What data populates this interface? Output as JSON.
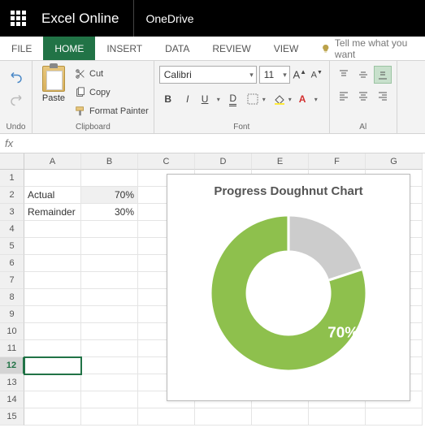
{
  "titlebar": {
    "app": "Excel Online",
    "location": "OneDrive"
  },
  "tabs": {
    "file": "FILE",
    "home": "HOME",
    "insert": "INSERT",
    "data": "DATA",
    "review": "REVIEW",
    "view": "VIEW",
    "tell": "Tell me what you want"
  },
  "ribbon": {
    "undo_label": "Undo",
    "clipboard": {
      "paste": "Paste",
      "cut": "Cut",
      "copy": "Copy",
      "format_painter": "Format Painter",
      "group": "Clipboard"
    },
    "font": {
      "name": "Calibri",
      "size": "11",
      "group": "Font"
    },
    "alignment": {
      "group": "Al"
    }
  },
  "formula_bar": {
    "fx": "fx"
  },
  "columns": [
    "A",
    "B",
    "C",
    "D",
    "E",
    "F",
    "G"
  ],
  "rows_visible": 15,
  "active_cell": "A12",
  "cells": {
    "A2": "Actual",
    "B2": "70%",
    "A3": "Remainder",
    "B3": "30%"
  },
  "chart_data": {
    "type": "doughnut",
    "title": "Progress Doughnut Chart",
    "series": [
      {
        "name": "Actual",
        "value": 70,
        "color": "#8ec04d"
      },
      {
        "name": "Remainder",
        "value": 30,
        "color": "#cccccc"
      }
    ],
    "data_label": "70%",
    "hole_ratio": 0.55
  }
}
